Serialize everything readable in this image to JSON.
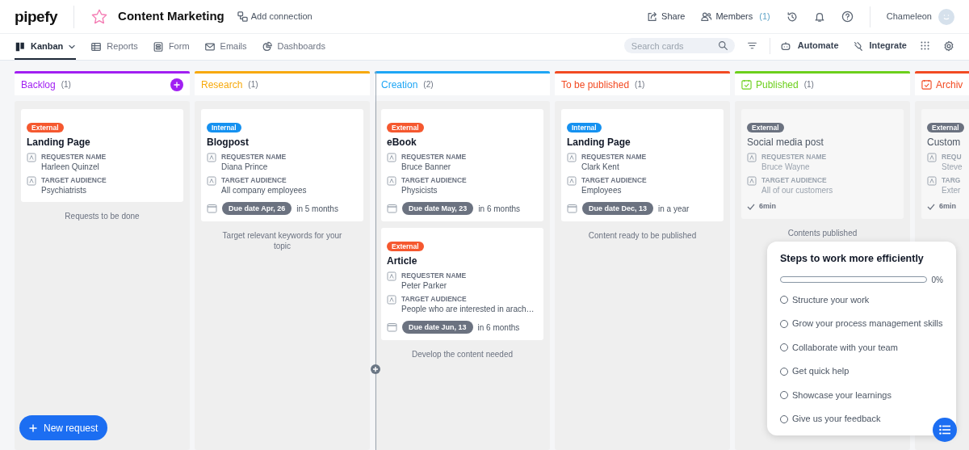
{
  "app": {
    "logo": "pipefy",
    "title": "Content Marketing",
    "add_connection": "Add connection"
  },
  "top_actions": [
    {
      "kind": "share",
      "label": "Share"
    },
    {
      "kind": "members",
      "label": "Members",
      "count": "(1)"
    }
  ],
  "user": {
    "name": "Chameleon"
  },
  "nav_tabs": [
    {
      "kind": "kanban",
      "label": "Kanban",
      "selected": true
    },
    {
      "kind": "reports",
      "label": "Reports",
      "selected": false
    },
    {
      "kind": "form",
      "label": "Form",
      "selected": false
    },
    {
      "kind": "emails",
      "label": "Emails",
      "selected": false
    },
    {
      "kind": "dashboards",
      "label": "Dashboards",
      "selected": false
    }
  ],
  "search": {
    "placeholder": "Search cards"
  },
  "tools": [
    {
      "kind": "automate",
      "label": "Automate"
    },
    {
      "kind": "integrate",
      "label": "Integrate"
    }
  ],
  "phases": [
    {
      "kind": "open",
      "name": "Backlog",
      "count": "(1)",
      "color": "#a11ff2",
      "add_button": true,
      "description": "Requests to be done",
      "cards": [
        {
          "tag": "External",
          "color": "#f5582f",
          "title": "Landing Page",
          "fields": [
            {
              "label": "REQUESTER NAME",
              "value": "Harleen Quinzel"
            },
            {
              "label": "TARGET AUDIENCE",
              "value": "Psychiatrists"
            }
          ]
        }
      ]
    },
    {
      "kind": "open",
      "name": "Research",
      "count": "(1)",
      "color": "#f7a90c",
      "description": "Target relevant keywords for your topic",
      "cards": [
        {
          "tag": "Internal",
          "color": "#1591f0",
          "title": "Blogpost",
          "fields": [
            {
              "label": "REQUESTER NAME",
              "value": "Diana Prince"
            },
            {
              "label": "TARGET AUDIENCE",
              "value": "All company employees"
            }
          ],
          "due": "Due date Apr, 26",
          "relative": "in 5 months"
        }
      ]
    },
    {
      "kind": "open",
      "name": "Creation",
      "count": "(2)",
      "color": "#1ea6f5",
      "description": "Develop the content needed",
      "cards": [
        {
          "tag": "External",
          "color": "#f5582f",
          "title": "eBook",
          "fields": [
            {
              "label": "REQUESTER NAME",
              "value": "Bruce Banner"
            },
            {
              "label": "TARGET AUDIENCE",
              "value": "Physicists"
            }
          ],
          "due": "Due date May, 23",
          "relative": "in 6 months"
        },
        {
          "tag": "External",
          "color": "#f5582f",
          "title": "Article",
          "fields": [
            {
              "label": "REQUESTER NAME",
              "value": "Peter Parker"
            },
            {
              "label": "TARGET AUDIENCE",
              "value": "People who are interested in arach…"
            }
          ],
          "due": "Due date Jun, 13",
          "relative": "in 6 months"
        }
      ]
    },
    {
      "kind": "open",
      "name": "To be published",
      "count": "(1)",
      "color": "#f24a22",
      "description": "Content ready to be published",
      "cards": [
        {
          "tag": "Internal",
          "color": "#1591f0",
          "title": "Landing Page",
          "fields": [
            {
              "label": "REQUESTER NAME",
              "value": "Clark Kent"
            },
            {
              "label": "TARGET AUDIENCE",
              "value": "Employees"
            }
          ],
          "due": "Due date Dec, 13",
          "relative": "in a year"
        }
      ]
    },
    {
      "kind": "done",
      "name": "Published",
      "count": "(1)",
      "color": "#6ccf1c",
      "description": "Contents published",
      "cards": [
        {
          "tag": "External",
          "color": "#6b7280",
          "title": "Social media post",
          "fields": [
            {
              "label": "REQUESTER NAME",
              "value": "Bruce Wayne"
            },
            {
              "label": "TARGET AUDIENCE",
              "value": "All of our customers"
            }
          ],
          "duration": "6min"
        }
      ]
    },
    {
      "kind": "done",
      "name": "Archiv",
      "color": "#f24a22",
      "cards": [
        {
          "tag": "External",
          "color": "#6b7280",
          "title": "Custom",
          "fields": [
            {
              "label": "REQU",
              "value": "Steve"
            },
            {
              "label": "TARG",
              "value": "Exter"
            }
          ],
          "duration": "6min"
        }
      ]
    }
  ],
  "steps_panel": {
    "title": "Steps to work more efficiently",
    "level": 0,
    "percent": "0%",
    "steps": [
      {
        "label": "Structure your work",
        "checked": false
      },
      {
        "label": "Grow your process management skills",
        "checked": false
      },
      {
        "label": "Collaborate with your team",
        "checked": false
      },
      {
        "label": "Get quick help",
        "checked": false
      },
      {
        "label": "Showcase your learnings",
        "checked": false
      },
      {
        "label": "Give us your feedback",
        "checked": false
      }
    ]
  },
  "new_request": {
    "label": "New request"
  }
}
